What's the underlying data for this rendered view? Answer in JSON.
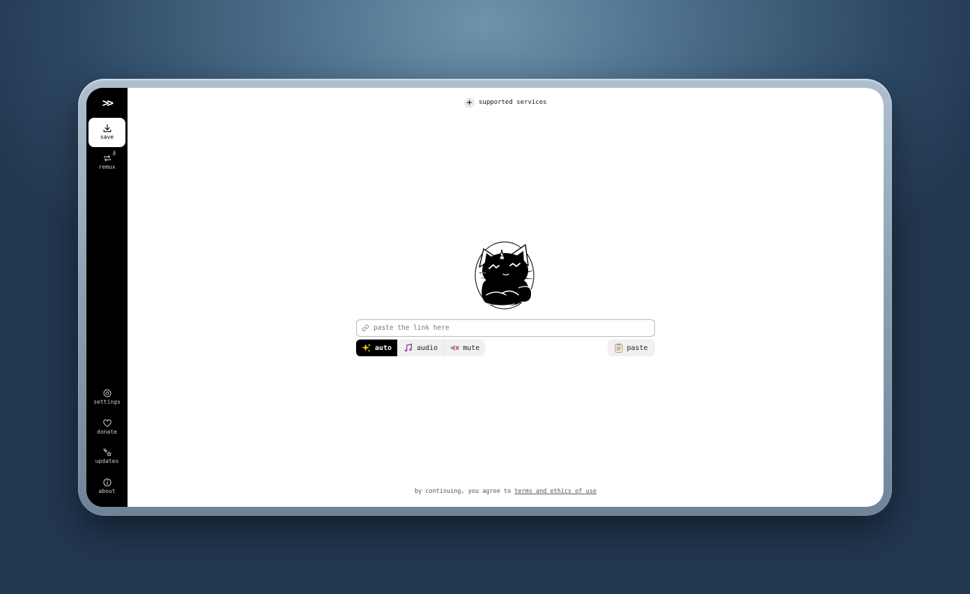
{
  "sidebar": {
    "logo": ">>",
    "items": [
      {
        "label": "save",
        "icon": "download-icon",
        "active": true
      },
      {
        "label": "remux",
        "icon": "remux-icon",
        "badge": "β"
      },
      {
        "label": "settings",
        "icon": "gear-icon"
      },
      {
        "label": "donate",
        "icon": "heart-icon"
      },
      {
        "label": "updates",
        "icon": "star-icon"
      },
      {
        "label": "about",
        "icon": "info-icon"
      }
    ]
  },
  "header": {
    "services_label": "supported services"
  },
  "input": {
    "placeholder": "paste the link here",
    "value": ""
  },
  "modes": [
    {
      "label": "auto",
      "icon": "sparkles-icon",
      "active": true
    },
    {
      "label": "audio",
      "icon": "music-icon"
    },
    {
      "label": "mute",
      "icon": "mute-icon"
    }
  ],
  "paste_label": "paste",
  "footer": {
    "prefix": "by continuing, you agree to",
    "link": "terms and ethics of use"
  }
}
